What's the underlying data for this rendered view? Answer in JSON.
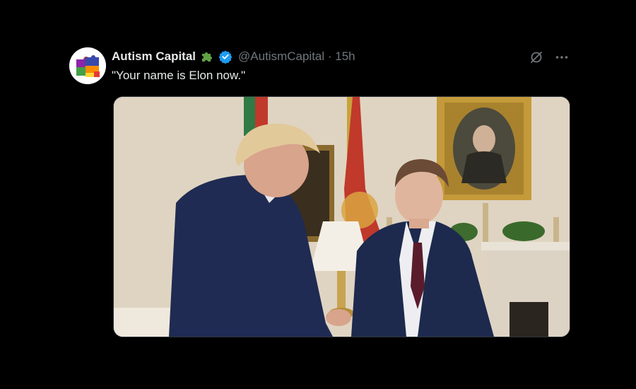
{
  "tweet": {
    "display_name": "Autism Capital",
    "handle_time": "@AutismCapital · 15h",
    "text": "\"Your name is Elon now.\"",
    "icons": {
      "avatar": "puzzle-logo-icon",
      "badge_puzzle": "green-puzzle-icon",
      "badge_verified": "verified-check-icon",
      "grok": "grok-icon",
      "more": "more-horizontal-icon"
    },
    "media": {
      "icon": "photo-image"
    }
  },
  "colors": {
    "background": "#000000",
    "text_primary": "#e7e9ea",
    "text_secondary": "#71767b",
    "verified_blue": "#1d9bf0",
    "puzzle_green": "#5fa244"
  }
}
